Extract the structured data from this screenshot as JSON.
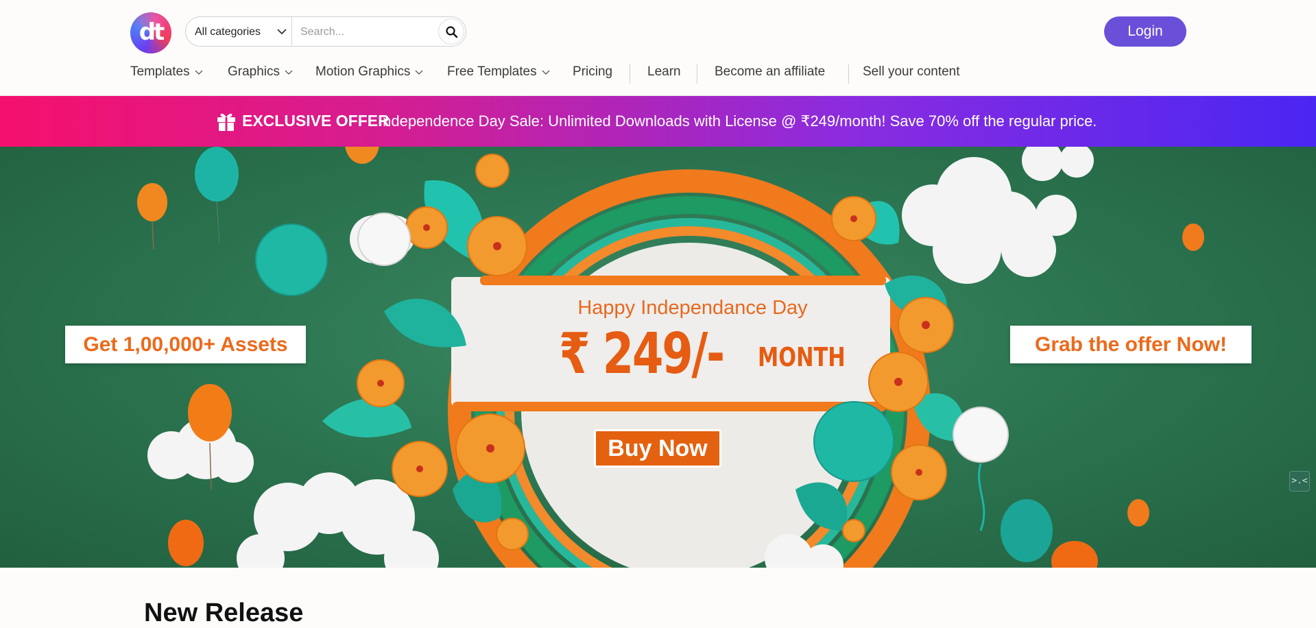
{
  "header": {
    "logo_text": "dt",
    "search": {
      "category": "All categories",
      "placeholder": "Search..."
    },
    "login_label": "Login"
  },
  "nav": {
    "items": [
      {
        "label": "Templates",
        "dropdown": true
      },
      {
        "label": "Graphics",
        "dropdown": true
      },
      {
        "label": "Motion Graphics",
        "dropdown": true
      },
      {
        "label": "Free Templates",
        "dropdown": true
      },
      {
        "label": "Pricing",
        "dropdown": false
      },
      {
        "label": "Learn",
        "dropdown": false
      },
      {
        "label": "Become an affiliate",
        "dropdown": false
      },
      {
        "label": "Sell your content",
        "dropdown": false
      }
    ]
  },
  "offer": {
    "icon": "gift-icon",
    "strong": "EXCLUSIVE OFFER",
    "text": "Independence Day Sale: Unlimited Downloads with License @ ₹249/month! Save 70% off the regular price."
  },
  "hero": {
    "left_tag": "Get 1,00,000+ Assets",
    "right_tag": "Grab the offer Now!",
    "subtitle": "Happy Independance Day",
    "price": "₹ 249/-",
    "price_unit": "MONTH",
    "cta": "Buy Now",
    "float_control": ">.<"
  },
  "section": {
    "title": "New Release"
  },
  "colors": {
    "brand": "#6a4fd8",
    "offer_start": "#f5106d",
    "offer_end": "#4a26f2",
    "hero_green": "#2c7651",
    "saffron": "#e65c12",
    "teal": "#1fb8a5"
  }
}
